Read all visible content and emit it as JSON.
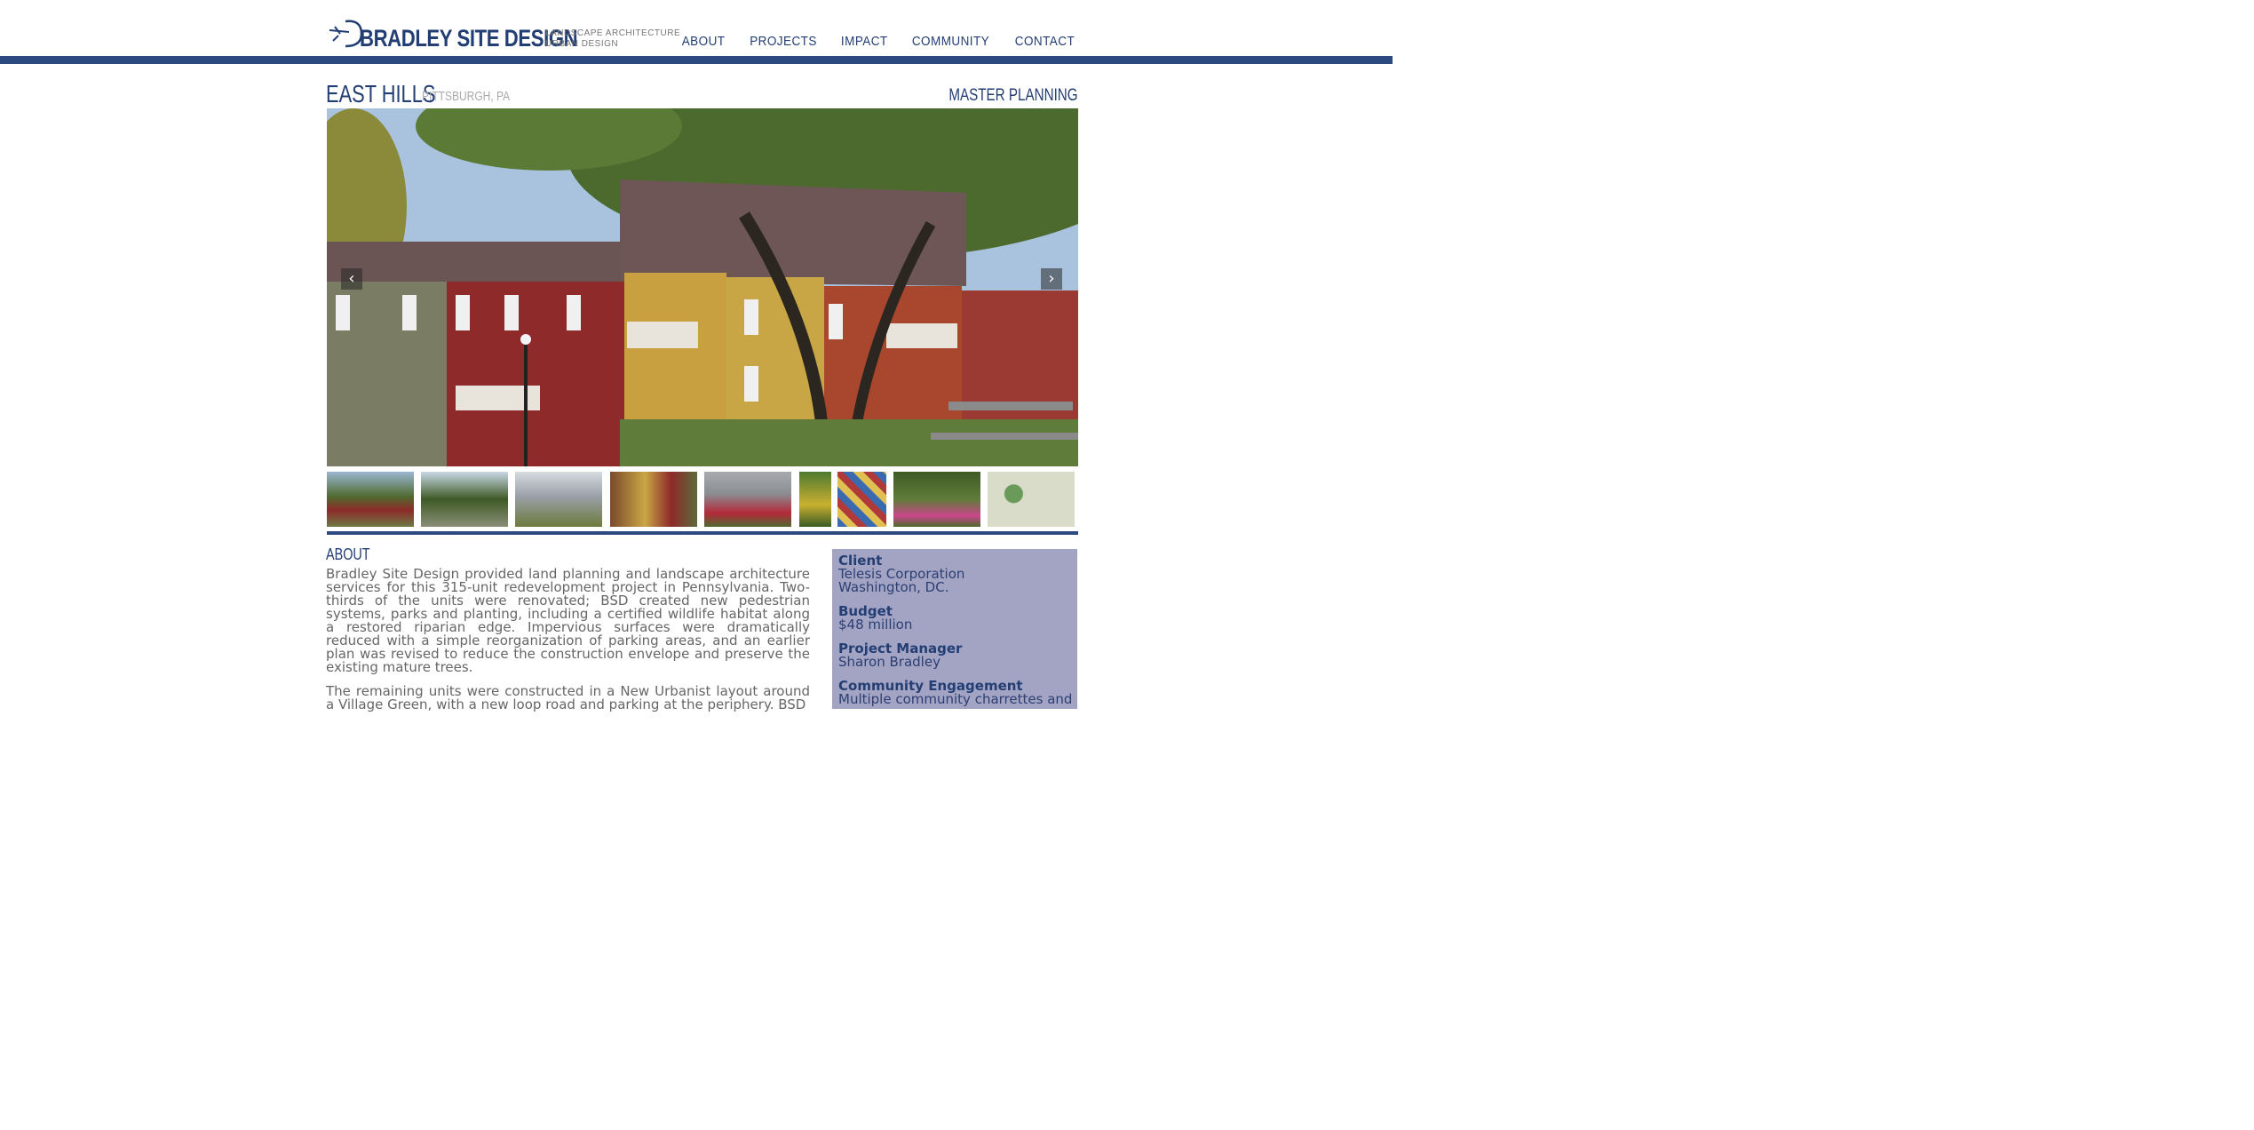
{
  "header": {
    "logo_name": "BRADLEY SITE DESIGN",
    "tagline_1": "LANDSCAPE ARCHITECTURE",
    "tagline_2": "URBAN DESIGN",
    "nav": [
      "ABOUT",
      "PROJECTS",
      "IMPACT",
      "COMMUNITY",
      "CONTACT"
    ]
  },
  "project": {
    "title": "EAST HILLS",
    "location": "PITTSBURGH, PA",
    "category": "MASTER PLANNING"
  },
  "carousel": {
    "prev_icon": "chevron-left-icon",
    "next_icon": "chevron-right-icon",
    "thumbnail_count": 9
  },
  "about": {
    "heading": "ABOUT",
    "paragraph_1": "Bradley Site Design provided land planning and landscape architecture services for this 315-unit redevelopment project in Pennsylvania. Two-thirds of the units were renovated; BSD created new pedestrian systems, parks and planting, including a certified wildlife habitat along a restored riparian edge. Impervious surfaces were dramatically reduced with a simple reorganization of parking areas, and an earlier plan was revised to reduce the construction envelope and preserve the existing mature trees.",
    "paragraph_2": "The remaining units were constructed in a New Urbanist layout around a Village Green, with a new loop road and parking at the periphery. BSD"
  },
  "details": {
    "client_label": "Client",
    "client_1": "Telesis Corporation",
    "client_2": "Washington, DC.",
    "budget_label": "Budget",
    "budget": "$48 million",
    "manager_label": "Project Manager",
    "manager": "Sharon Bradley",
    "engagement_label": "Community Engagement",
    "engagement": "Multiple community charrettes and"
  },
  "colors": {
    "brand": "#233e73",
    "bar": "#2c4a80",
    "sidebar": "#a3a3c3"
  }
}
